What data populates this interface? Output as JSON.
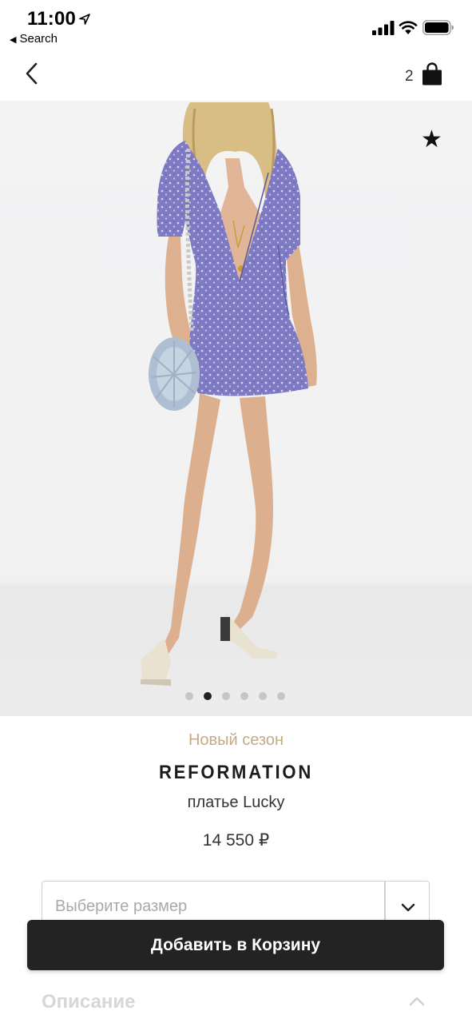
{
  "status_bar": {
    "time": "11:00",
    "back_app_label": "Search",
    "icons": [
      "location-arrow-icon",
      "signal-icon",
      "wifi-icon",
      "battery-icon"
    ]
  },
  "nav": {
    "back_icon": "chevron-left-icon",
    "cart_count": "2",
    "cart_icon": "shopping-bag-icon"
  },
  "gallery": {
    "favorite_icon": "star-icon",
    "image_count": 6,
    "active_index": 1
  },
  "product": {
    "season_label": "Новый сезон",
    "brand": "REFORMATION",
    "name": "платье Lucky",
    "price": "14 550 ₽"
  },
  "size_select": {
    "placeholder": "Выберите размер",
    "icon": "chevron-down-icon"
  },
  "add_to_cart": {
    "label": "Добавить в Корзину"
  },
  "description": {
    "title": "Описание",
    "icon": "chevron-up-icon"
  },
  "colors": {
    "season_accent": "#c4aa86",
    "button_bg": "#232323",
    "dress": "#7d79c2"
  }
}
